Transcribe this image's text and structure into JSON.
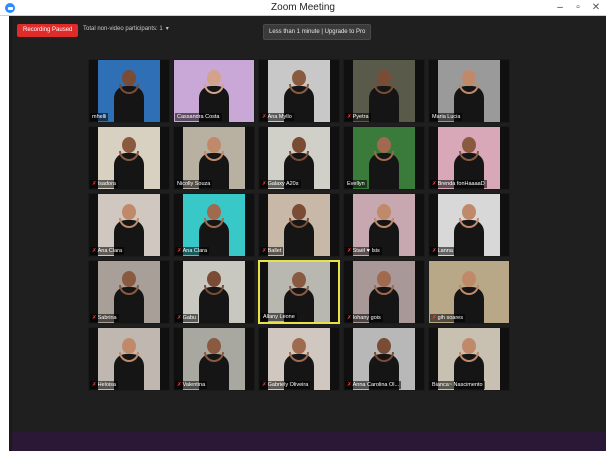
{
  "window": {
    "title": "Zoom Meeting",
    "minimize_glyph": "–",
    "maximize_glyph": "▫",
    "close_glyph": "✕"
  },
  "toolbar": {
    "recording_label": "Recording Paused",
    "nonvideo_label": "Total non-video participants: 1",
    "nonvideo_chevron": "▾",
    "upgrade_label": "Less than 1 minute | Upgrade to Pro"
  },
  "colors": {
    "accent_red": "#e02b2b",
    "active_speaker": "#e8e24a",
    "background": "#1f1f1f",
    "bottom_bar": "#2a1836"
  },
  "participants": [
    {
      "name": "mhelli",
      "muted": false,
      "bg": "#2e6fb5",
      "skin": "#7a4c35",
      "full": false
    },
    {
      "name": "Cassandra Costa",
      "muted": false,
      "bg": "#c9a8d8",
      "skin": "#d4a28a",
      "full": true
    },
    {
      "name": "Ana Myllo",
      "muted": true,
      "bg": "#c8c8c8",
      "skin": "#8a5a40",
      "full": false
    },
    {
      "name": "Pyetra",
      "muted": true,
      "bg": "#5a5a4a",
      "skin": "#7a4c35",
      "full": false
    },
    {
      "name": "Maria Lucia",
      "muted": false,
      "bg": "#9a9a9a",
      "skin": "#c08a6a",
      "full": false
    },
    {
      "name": "Isadora",
      "muted": true,
      "bg": "#d8d0c0",
      "skin": "#8a5a40",
      "full": false
    },
    {
      "name": "Nicolly Souza",
      "muted": false,
      "bg": "#b8b0a0",
      "skin": "#c08a6a",
      "full": false
    },
    {
      "name": "Galaxy A20s",
      "muted": true,
      "bg": "#d0d0c8",
      "skin": "#7a4c35",
      "full": false
    },
    {
      "name": "Evellyn",
      "muted": false,
      "bg": "#3a7a3a",
      "skin": "#a06a4e",
      "full": false
    },
    {
      "name": "Brenda fonHaaaaD",
      "muted": true,
      "bg": "#d8a8b8",
      "skin": "#8a5a40",
      "full": false
    },
    {
      "name": "Ana Clara",
      "muted": true,
      "bg": "#d0c8c0",
      "skin": "#c08a6a",
      "full": false
    },
    {
      "name": "Ana Clara",
      "muted": true,
      "bg": "#38c8c8",
      "skin": "#a06a4e",
      "full": false
    },
    {
      "name": "Ballet",
      "muted": true,
      "bg": "#c8b8a8",
      "skin": "#7a4c35",
      "full": false
    },
    {
      "name": "Staël ♥ Isis",
      "muted": true,
      "bg": "#c8a8b0",
      "skin": "#c08a6a",
      "full": false
    },
    {
      "name": "Lanna",
      "muted": true,
      "bg": "#d8d8d8",
      "skin": "#c08a6a",
      "full": false
    },
    {
      "name": "Sabrina",
      "muted": true,
      "bg": "#a8a098",
      "skin": "#8a5a40",
      "full": false
    },
    {
      "name": "Gabu",
      "muted": true,
      "bg": "#c8c8c0",
      "skin": "#7a4c35",
      "full": false
    },
    {
      "name": "Allany Leone",
      "muted": false,
      "bg": "#b8b8b0",
      "skin": "#8a5a40",
      "full": false
    },
    {
      "name": "Iohany gois",
      "muted": true,
      "bg": "#a89898",
      "skin": "#a06a4e",
      "full": false
    },
    {
      "name": "gih soares",
      "muted": true,
      "bg": "#b8a888",
      "skin": "#c08a6a",
      "full": true
    },
    {
      "name": "Heloisa",
      "muted": true,
      "bg": "#c0b8b0",
      "skin": "#c08a6a",
      "full": false
    },
    {
      "name": "Valentina",
      "muted": true,
      "bg": "#a8a8a0",
      "skin": "#8a5a40",
      "full": false
    },
    {
      "name": "Gabriely Oliveira",
      "muted": true,
      "bg": "#d0c8c0",
      "skin": "#a06a4e",
      "full": false
    },
    {
      "name": "Anna Carolina Ol...",
      "muted": true,
      "bg": "#b8b8b8",
      "skin": "#7a4c35",
      "full": false
    },
    {
      "name": "Bianca~ Nascimento",
      "muted": false,
      "bg": "#c8c0b0",
      "skin": "#c08a6a",
      "full": false
    }
  ],
  "active_speaker_index": 17
}
